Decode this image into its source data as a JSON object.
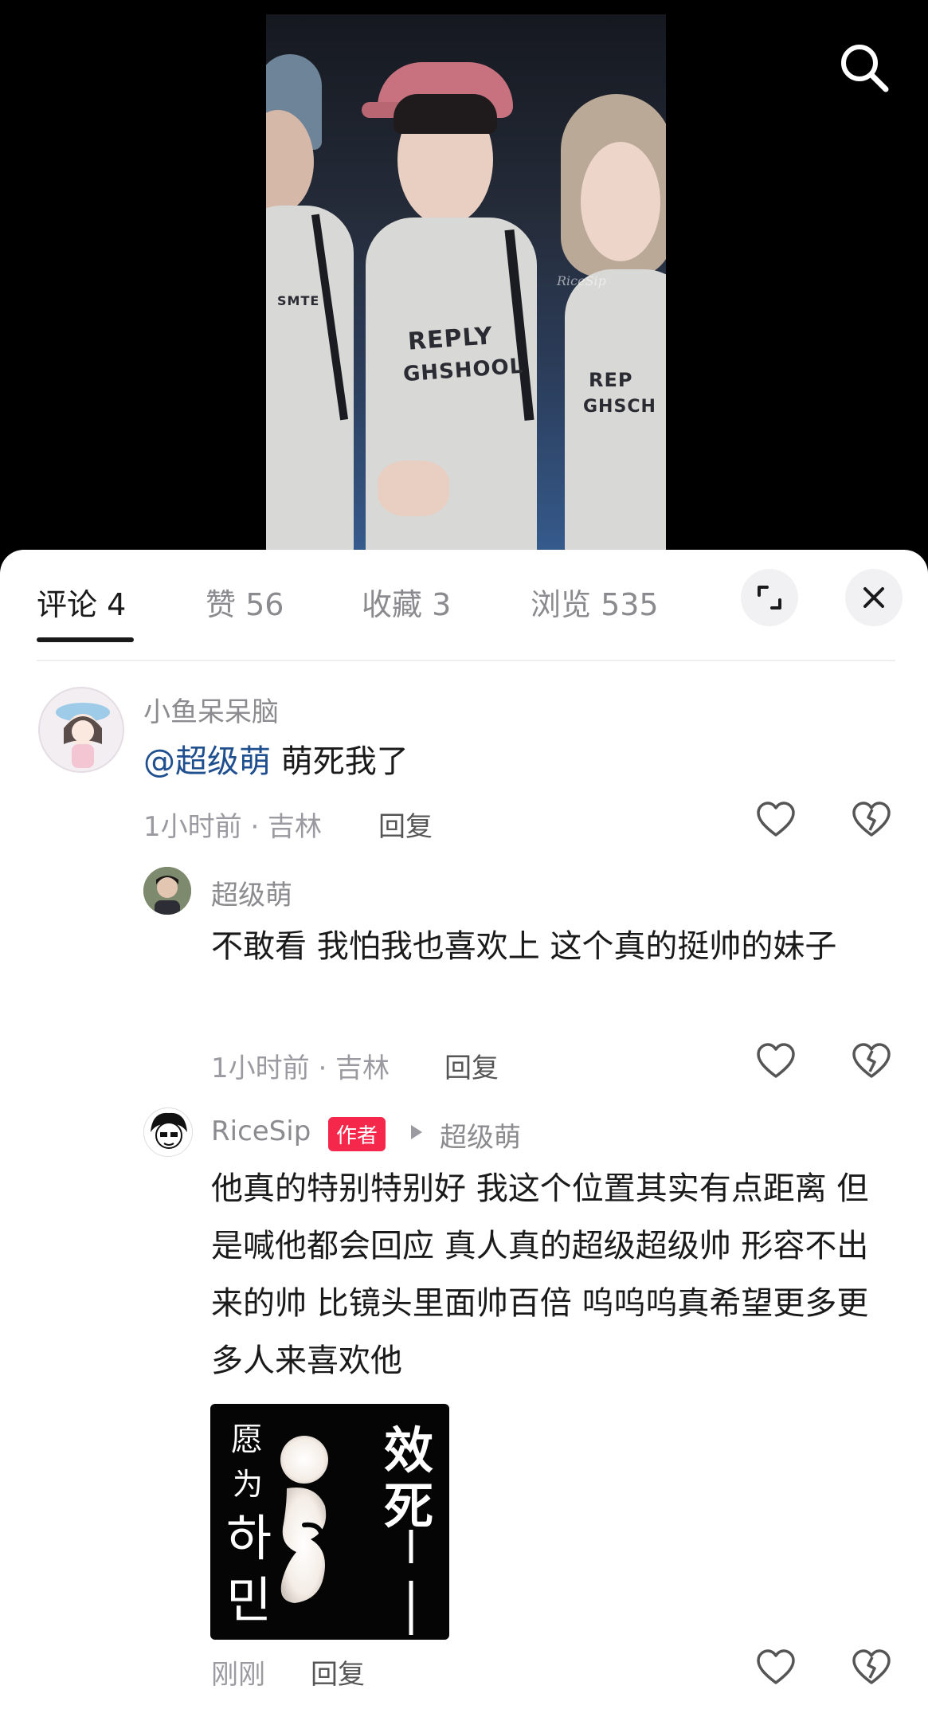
{
  "tabs": [
    {
      "label": "评论 4"
    },
    {
      "label": "赞 56"
    },
    {
      "label": "收藏 3"
    },
    {
      "label": "浏览 535"
    }
  ],
  "photo": {
    "watermark": "RiceSip",
    "shirt_print_left": "SMTE",
    "shirt_print_mid1": "REPLY",
    "shirt_print_mid2": "GHSHOOL",
    "shirt_print_right1": "REP",
    "shirt_print_right2": "GHSCH"
  },
  "comments": [
    {
      "username": "小鱼呆呆脑",
      "mention": "@超级萌",
      "text": " 萌死我了",
      "meta": "1小时前 · 吉林",
      "reply": "回复"
    },
    {
      "username": "超级萌",
      "text": "不敢看 我怕我也喜欢上 这个真的挺帅的妹子",
      "meta": "1小时前 · 吉林",
      "reply": "回复"
    },
    {
      "username": "RiceSip",
      "author_tag": "作者",
      "reply_to": "超级萌",
      "text": "他真的特别特别好 我这个位置其实有点距离 但是喊他都会回应 真人真的超级超级帅 形容不出来的帅 比镜头里面帅百倍 呜呜呜真希望更多更多人来喜欢他",
      "meta": "刚刚",
      "reply": "回复"
    }
  ],
  "sticker": {
    "left_top": "愿",
    "left_mid": "为",
    "korean1": "하",
    "korean2": "민",
    "right1": "效",
    "right2": "死"
  },
  "colors": {
    "accent_red": "#f5284b",
    "mention_blue": "#1f4f8f",
    "text": "#1a1a1a",
    "muted": "#8c8c90"
  },
  "icons": [
    "search-icon",
    "expand-icon",
    "close-icon",
    "like-heart-icon",
    "dislike-broken-heart-icon"
  ]
}
